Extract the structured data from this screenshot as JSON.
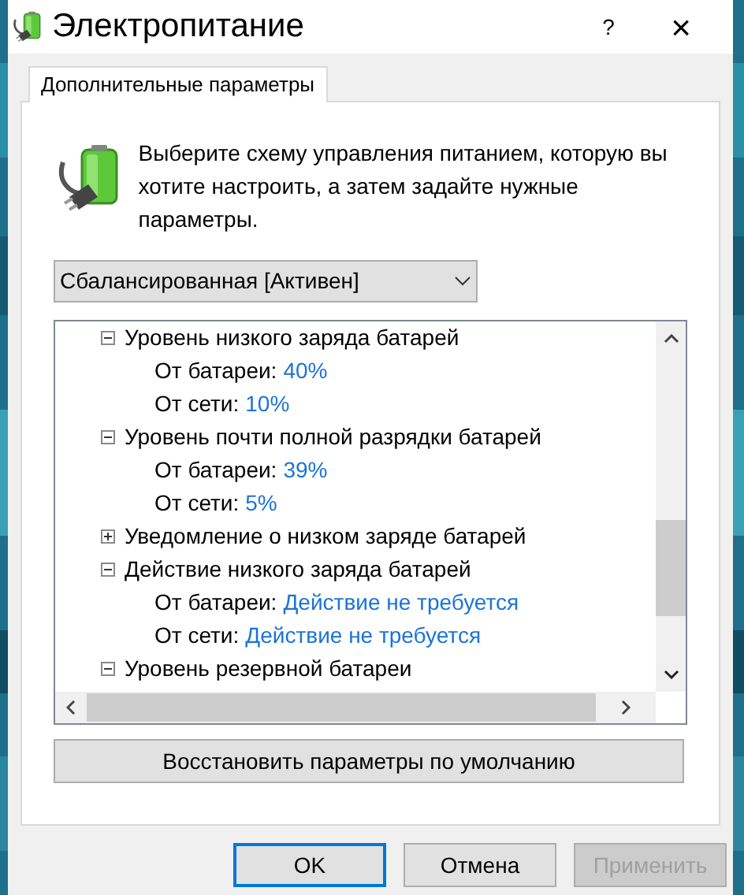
{
  "window": {
    "title": "Электропитание",
    "help": "?",
    "close": "×"
  },
  "tabs": [
    {
      "label": "Дополнительные параметры",
      "selected": true
    }
  ],
  "intro": "Выберите схему управления питанием, которую вы хотите настроить, а затем задайте нужные параметры.",
  "plan_select": {
    "value": "Сбалансированная [Активен]"
  },
  "settings_tree": [
    {
      "label": "Уровень низкого заряда батарей",
      "expanded": true,
      "children": [
        {
          "label": "От батареи:",
          "value": "40%"
        },
        {
          "label": "От сети:",
          "value": "10%"
        }
      ]
    },
    {
      "label": "Уровень почти полной разрядки батарей",
      "expanded": true,
      "children": [
        {
          "label": "От батареи:",
          "value": "39%"
        },
        {
          "label": "От сети:",
          "value": "5%"
        }
      ]
    },
    {
      "label": "Уведомление о низком заряде батарей",
      "expanded": false
    },
    {
      "label": "Действие низкого заряда батарей",
      "expanded": true,
      "children": [
        {
          "label": "От батареи:",
          "value": "Действие не требуется"
        },
        {
          "label": "От сети:",
          "value": "Действие не требуется"
        }
      ]
    },
    {
      "label": "Уровень резервной батареи",
      "expanded": true
    }
  ],
  "restore_button": "Восстановить параметры по умолчанию",
  "buttons": [
    {
      "label": "OK",
      "kind": "default",
      "disabled": false
    },
    {
      "label": "Отмена",
      "kind": "normal",
      "disabled": false
    },
    {
      "label": "Применить",
      "kind": "normal",
      "disabled": true
    }
  ]
}
